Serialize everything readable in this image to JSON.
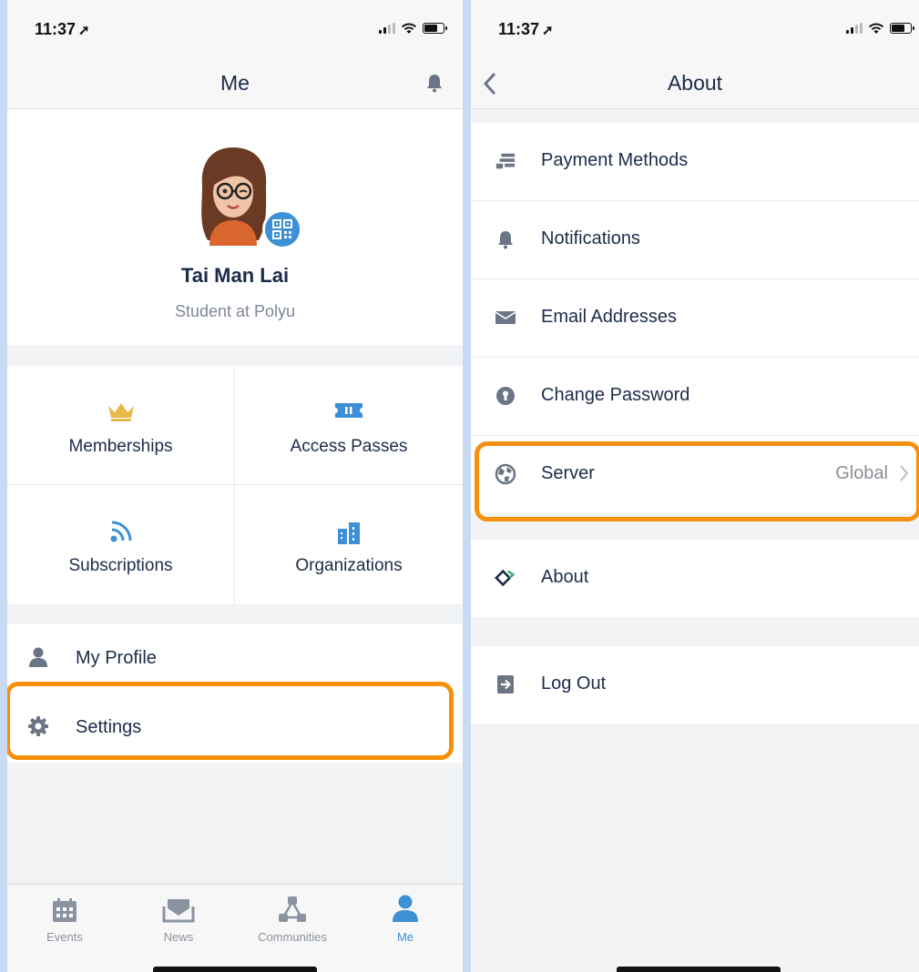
{
  "left": {
    "status_time": "11:37",
    "nav_title": "Me",
    "profile": {
      "name": "Tai Man Lai",
      "subtitle": "Student at Polyu"
    },
    "grid": [
      {
        "label": "Memberships",
        "icon": "crown-icon"
      },
      {
        "label": "Access Passes",
        "icon": "ticket-icon"
      },
      {
        "label": "Subscriptions",
        "icon": "rss-icon"
      },
      {
        "label": "Organizations",
        "icon": "buildings-icon"
      }
    ],
    "menu": [
      {
        "label": "My Profile",
        "icon": "person-icon"
      },
      {
        "label": "Settings",
        "icon": "gear-icon"
      }
    ],
    "tabs": [
      {
        "label": "Events",
        "icon": "calendar-icon"
      },
      {
        "label": "News",
        "icon": "envelope-icon"
      },
      {
        "label": "Communities",
        "icon": "network-icon"
      },
      {
        "label": "Me",
        "icon": "person-icon"
      }
    ]
  },
  "right": {
    "status_time": "11:37",
    "nav_title": "About",
    "settings_group": [
      {
        "label": "Payment Methods",
        "icon": "wallet-icon"
      },
      {
        "label": "Notifications",
        "icon": "bell-icon"
      },
      {
        "label": "Email Addresses",
        "icon": "envelope-icon"
      },
      {
        "label": "Change Password",
        "icon": "keyhole-icon"
      },
      {
        "label": "Server",
        "icon": "globe-icon",
        "value": "Global"
      }
    ],
    "about": {
      "label": "About",
      "icon": "diamond-icon"
    },
    "logout": {
      "label": "Log Out",
      "icon": "logout-icon"
    }
  },
  "colors": {
    "accent": "#3d8fd6",
    "highlight": "#f7900c",
    "crown": "#e9b84a",
    "text": "#1c2b4a"
  }
}
